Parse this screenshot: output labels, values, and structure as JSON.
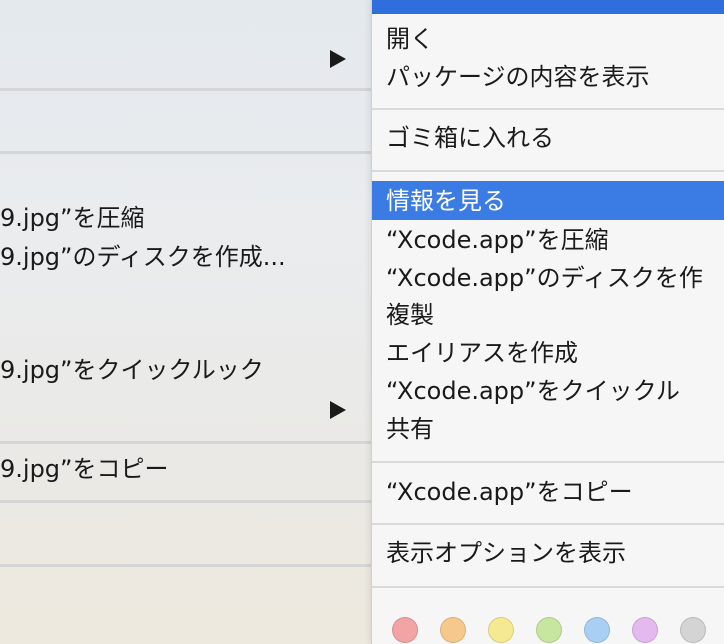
{
  "left_menu": {
    "items": [
      "9.jpg”を圧縮",
      "9.jpg”のディスクを作成...",
      "9.jpg”をクイックルック",
      "9.jpg”をコピー"
    ],
    "submenu_arrow_icon": "triangle-right-icon"
  },
  "right_menu": {
    "items": {
      "open": "開く",
      "show_package_contents": "パッケージの内容を表示",
      "move_to_trash": "ゴミ箱に入れる",
      "get_info": "情報を見る",
      "compress": "“Xcode.app”を圧縮",
      "burn_disc": "“Xcode.app”のディスクを作",
      "duplicate": "複製",
      "make_alias": "エイリアスを作成",
      "quick_look": "“Xcode.app”をクイックル",
      "share": "共有",
      "copy": "“Xcode.app”をコピー",
      "show_view_options": "表示オプションを表示"
    },
    "highlight_color": "#3b7be4",
    "tag_colors": [
      "#f2a3a3",
      "#f6c88c",
      "#f6ea90",
      "#c7e6a0",
      "#a9cff4",
      "#e3b9ef",
      "#d4d4d4"
    ]
  }
}
